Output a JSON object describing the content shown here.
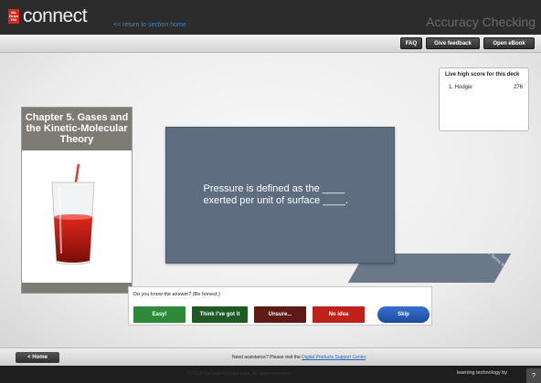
{
  "header": {
    "logo_mark": [
      "Mc",
      "Graw",
      "Hill"
    ],
    "logo_text": "connect",
    "return_link": "<< return to section home",
    "assignment_title": "Accuracy Checking"
  },
  "toolbar": {
    "faq": "FAQ",
    "feedback": "Give feedback",
    "ebook": "Open eBook"
  },
  "high_score": {
    "title": "Live high score for this deck",
    "entries": [
      {
        "rank_name": "1. Hodgie",
        "score": "276"
      }
    ]
  },
  "chapter": {
    "title": "Chapter 5. Gases and the Kinetic-Molecular Theory"
  },
  "flashcard": {
    "question": "Pressure is defined as the ____\nexerted per unit of surface ____."
  },
  "card_back": {
    "label": "5-4 Terms left"
  },
  "answer": {
    "prompt": "Do you know the answer? (Be honest.)",
    "buttons": [
      {
        "label": "Easy!",
        "color": "#2e8a3a"
      },
      {
        "label": "Think I've got it",
        "color": "#1f5a24"
      },
      {
        "label": "Unsure...",
        "color": "#5e1a14"
      },
      {
        "label": "No idea",
        "color": "#c0221a"
      }
    ],
    "skip": "Skip"
  },
  "bottom": {
    "home": "< Home",
    "assist_text": "Need assistance? Please visit the ",
    "assist_link": "Digital Products Support Center"
  },
  "footer": {
    "copyright": "© 2013 McGraw-Hill Education. All rights reserved.",
    "learning_tech": "learning technology by",
    "help": "?"
  }
}
